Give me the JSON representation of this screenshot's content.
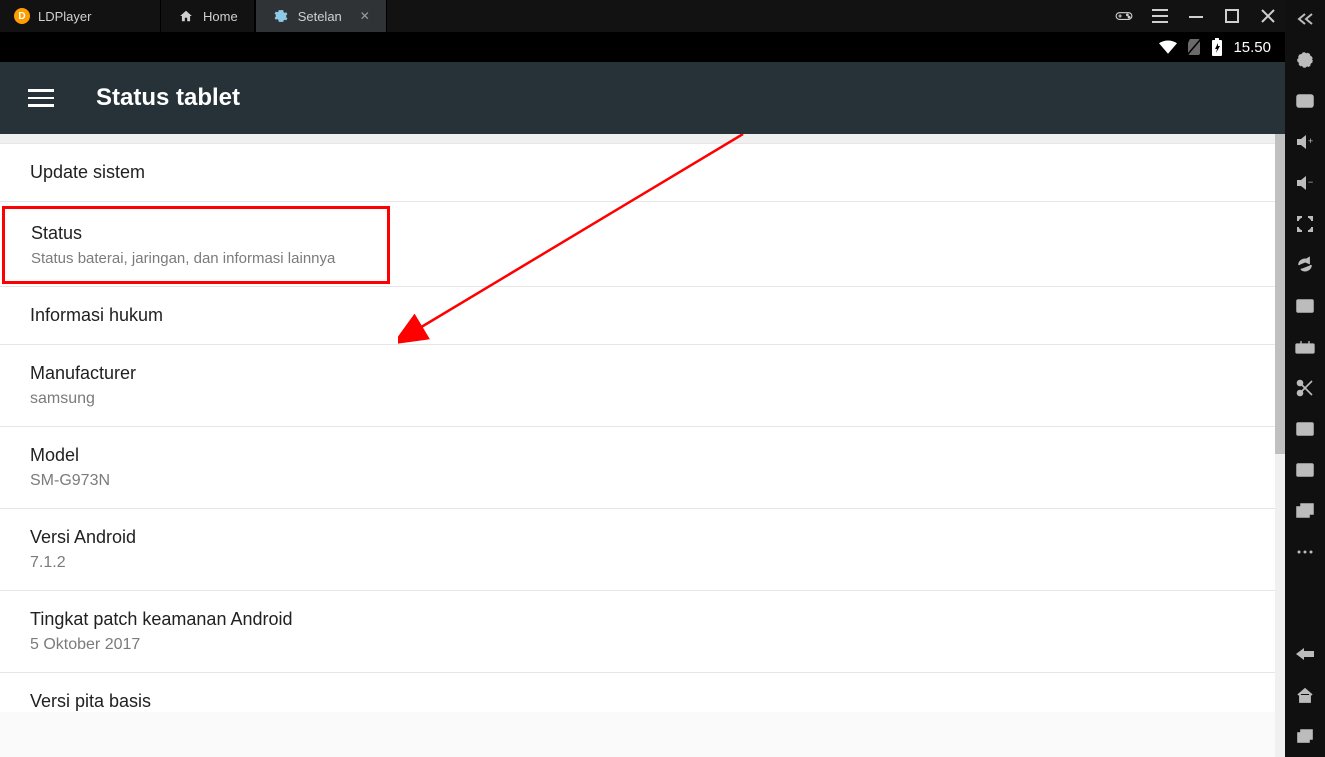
{
  "app": {
    "name": "LDPlayer"
  },
  "tabs": {
    "home": "Home",
    "settings": "Setelan"
  },
  "statusbar": {
    "time": "15.50"
  },
  "header": {
    "title": "Status tablet"
  },
  "list": {
    "update": {
      "title": "Update sistem"
    },
    "status": {
      "title": "Status",
      "sub": "Status baterai, jaringan, dan informasi lainnya"
    },
    "legal": {
      "title": "Informasi hukum"
    },
    "manufacturer": {
      "title": "Manufacturer",
      "sub": "samsung"
    },
    "model": {
      "title": "Model",
      "sub": "SM-G973N"
    },
    "android": {
      "title": "Versi Android",
      "sub": "7.1.2"
    },
    "patch": {
      "title": "Tingkat patch keamanan Android",
      "sub": "5 Oktober 2017"
    },
    "baseband": {
      "title": "Versi pita basis"
    }
  }
}
